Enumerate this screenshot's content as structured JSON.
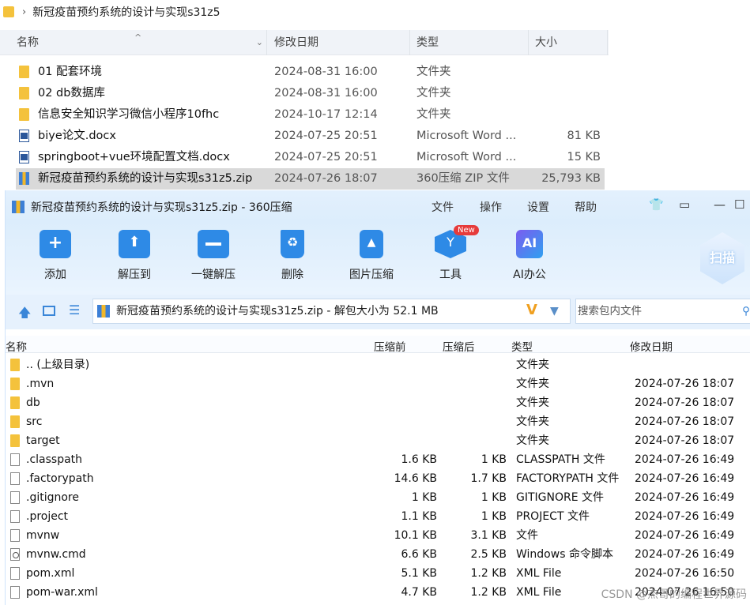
{
  "explorer": {
    "breadcrumb": "新冠疫苗预约系统的设计与实现s31z5",
    "columns": {
      "name": "名称",
      "modified": "修改日期",
      "type": "类型",
      "size": "大小"
    },
    "files": [
      {
        "name": "01 配套环境",
        "modified": "2024-08-31 16:00",
        "type": "文件夹",
        "size": "",
        "icon": "folder-icon"
      },
      {
        "name": "02 db数据库",
        "modified": "2024-08-31 16:00",
        "type": "文件夹",
        "size": "",
        "icon": "folder-icon"
      },
      {
        "name": "信息安全知识学习微信小程序10fhc",
        "modified": "2024-10-17 12:14",
        "type": "文件夹",
        "size": "",
        "icon": "folder-icon"
      },
      {
        "name": "biye论文.docx",
        "modified": "2024-07-25 20:51",
        "type": "Microsoft Word ...",
        "size": "81 KB",
        "icon": "word-doc-icon"
      },
      {
        "name": "springboot+vue环境配置文档.docx",
        "modified": "2024-07-25 20:51",
        "type": "Microsoft Word ...",
        "size": "15 KB",
        "icon": "word-doc-icon"
      },
      {
        "name": "新冠疫苗预约系统的设计与实现s31z5.zip",
        "modified": "2024-07-26 18:07",
        "type": "360压缩 ZIP 文件",
        "size": "25,793 KB",
        "icon": "zip-icon",
        "selected": true
      }
    ]
  },
  "zip_window": {
    "title": "新冠疫苗预约系统的设计与实现s31z5.zip - 360压缩",
    "menu": [
      "文件",
      "操作",
      "设置",
      "帮助"
    ],
    "tools": [
      {
        "label": "添加",
        "icon": "add-icon"
      },
      {
        "label": "解压到",
        "icon": "extract-to-icon"
      },
      {
        "label": "一键解压",
        "icon": "one-click-extract-icon"
      },
      {
        "label": "删除",
        "icon": "delete-icon"
      },
      {
        "label": "图片压缩",
        "icon": "image-compress-icon"
      },
      {
        "label": "工具",
        "icon": "tools-icon",
        "badge": "New"
      },
      {
        "label": "AI办公",
        "icon": "ai-office-icon",
        "badge_text": "AI"
      }
    ],
    "scan_label": "扫描",
    "path": "新冠疫苗预约系统的设计与实现s31z5.zip - 解包大小为 52.1 MB",
    "search_placeholder": "搜索包内文件",
    "columns": {
      "name": "名称",
      "before": "压缩前",
      "after": "压缩后",
      "type": "类型",
      "modified": "修改日期"
    },
    "entries": [
      {
        "name": ".. (上级目录)",
        "before": "",
        "after": "",
        "type": "文件夹",
        "modified": "",
        "kind": "folder"
      },
      {
        "name": ".mvn",
        "before": "",
        "after": "",
        "type": "文件夹",
        "modified": "2024-07-26 18:07",
        "kind": "folder"
      },
      {
        "name": "db",
        "before": "",
        "after": "",
        "type": "文件夹",
        "modified": "2024-07-26 18:07",
        "kind": "folder"
      },
      {
        "name": "src",
        "before": "",
        "after": "",
        "type": "文件夹",
        "modified": "2024-07-26 18:07",
        "kind": "folder"
      },
      {
        "name": "target",
        "before": "",
        "after": "",
        "type": "文件夹",
        "modified": "2024-07-26 18:07",
        "kind": "folder"
      },
      {
        "name": ".classpath",
        "before": "1.6 KB",
        "after": "1 KB",
        "type": "CLASSPATH 文件",
        "modified": "2024-07-26 16:49",
        "kind": "file"
      },
      {
        "name": ".factorypath",
        "before": "14.6 KB",
        "after": "1.7 KB",
        "type": "FACTORYPATH 文件",
        "modified": "2024-07-26 16:49",
        "kind": "file"
      },
      {
        "name": ".gitignore",
        "before": "1 KB",
        "after": "1 KB",
        "type": "GITIGNORE 文件",
        "modified": "2024-07-26 16:49",
        "kind": "file"
      },
      {
        "name": ".project",
        "before": "1.1 KB",
        "after": "1 KB",
        "type": "PROJECT 文件",
        "modified": "2024-07-26 16:49",
        "kind": "file"
      },
      {
        "name": "mvnw",
        "before": "10.1 KB",
        "after": "3.1 KB",
        "type": "文件",
        "modified": "2024-07-26 16:49",
        "kind": "file"
      },
      {
        "name": "mvnw.cmd",
        "before": "6.6 KB",
        "after": "2.5 KB",
        "type": "Windows 命令脚本",
        "modified": "2024-07-26 16:49",
        "kind": "cmd"
      },
      {
        "name": "pom.xml",
        "before": "5.1 KB",
        "after": "1.2 KB",
        "type": "XML File",
        "modified": "2024-07-26 16:50",
        "kind": "file"
      },
      {
        "name": "pom-war.xml",
        "before": "4.7 KB",
        "after": "1.2 KB",
        "type": "XML File",
        "modified": "2024-07-26 16:50",
        "kind": "file"
      }
    ]
  },
  "watermark": "CSDN @杰哥的编程世界源码"
}
